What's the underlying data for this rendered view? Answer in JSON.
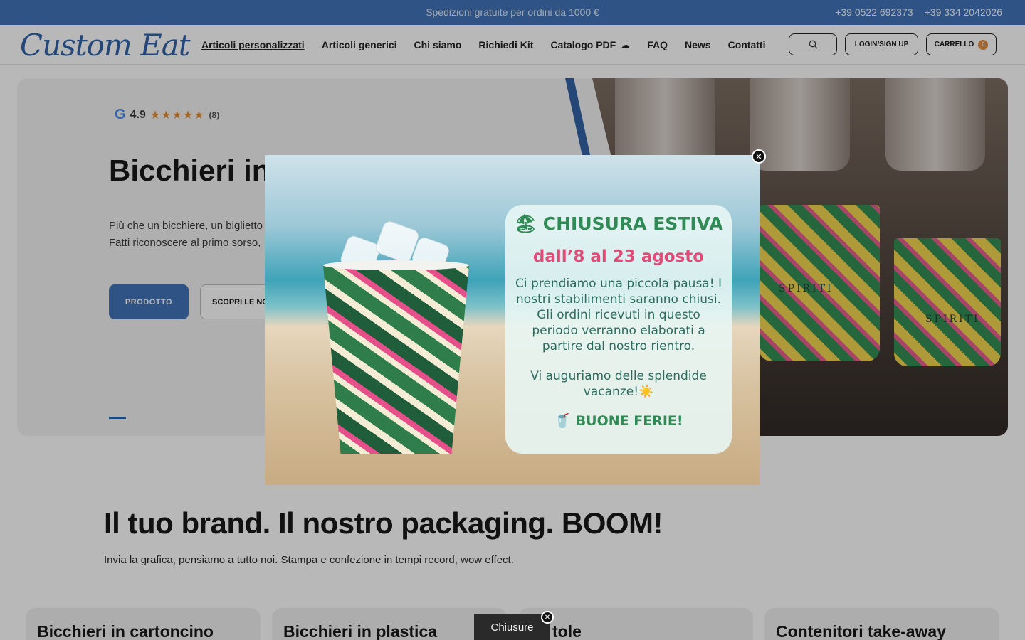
{
  "topbar": {
    "promo": "Spedizioni gratuite per ordini da 1000 €",
    "phone1": "+39 0522 692373",
    "phone2": "+39 334 2042026"
  },
  "header": {
    "logo": "Custom Eat",
    "nav": [
      "Articoli personalizzati",
      "Articoli generici",
      "Chi siamo",
      "Richiedi Kit",
      "Catalogo PDF",
      "FAQ",
      "News",
      "Contatti"
    ],
    "login_label": "LOGIN/SIGN UP",
    "cart_label": "CARRELLO",
    "cart_count": "0"
  },
  "hero": {
    "rating_value": "4.9",
    "rating_stars": "★★★★★",
    "rating_count": "(8)",
    "title": "Bicchieri in C",
    "desc_line1": "Più che un bicchiere, un biglietto",
    "desc_line2": "Fatti riconoscere al primo sorso,",
    "primary_btn": "PRODOTTO",
    "secondary_btn": "SCOPRI LE NO",
    "cup_brand": "SPIRITI"
  },
  "section": {
    "title": "Il tuo brand. Il nostro packaging. BOOM!",
    "subtitle": "Invia la grafica, pensiamo a tutto noi. Stampa e confezione in tempi record, wow effect.",
    "cards": [
      "Bicchieri in cartoncino",
      "Bicchieri in plastica",
      "tole",
      "Contenitori take-away"
    ]
  },
  "modal": {
    "title": "🏖 CHIUSURA ESTIVA",
    "dates": "dall’8 al 23 agosto",
    "body": "Ci prendiamo una piccola pausa! I nostri stabilimenti saranno chiusi. Gli ordini ricevuti in questo periodo verranno elaborati a partire dal nostro rientro.",
    "wish": "Vi auguriamo delle splendide vacanze!☀️",
    "bye": "🥤 BUONE FERIE!"
  },
  "toast": {
    "label": "Chiusure"
  },
  "colors": {
    "brand_blue": "#3a6fb5",
    "accent_orange": "#e08b3b"
  }
}
